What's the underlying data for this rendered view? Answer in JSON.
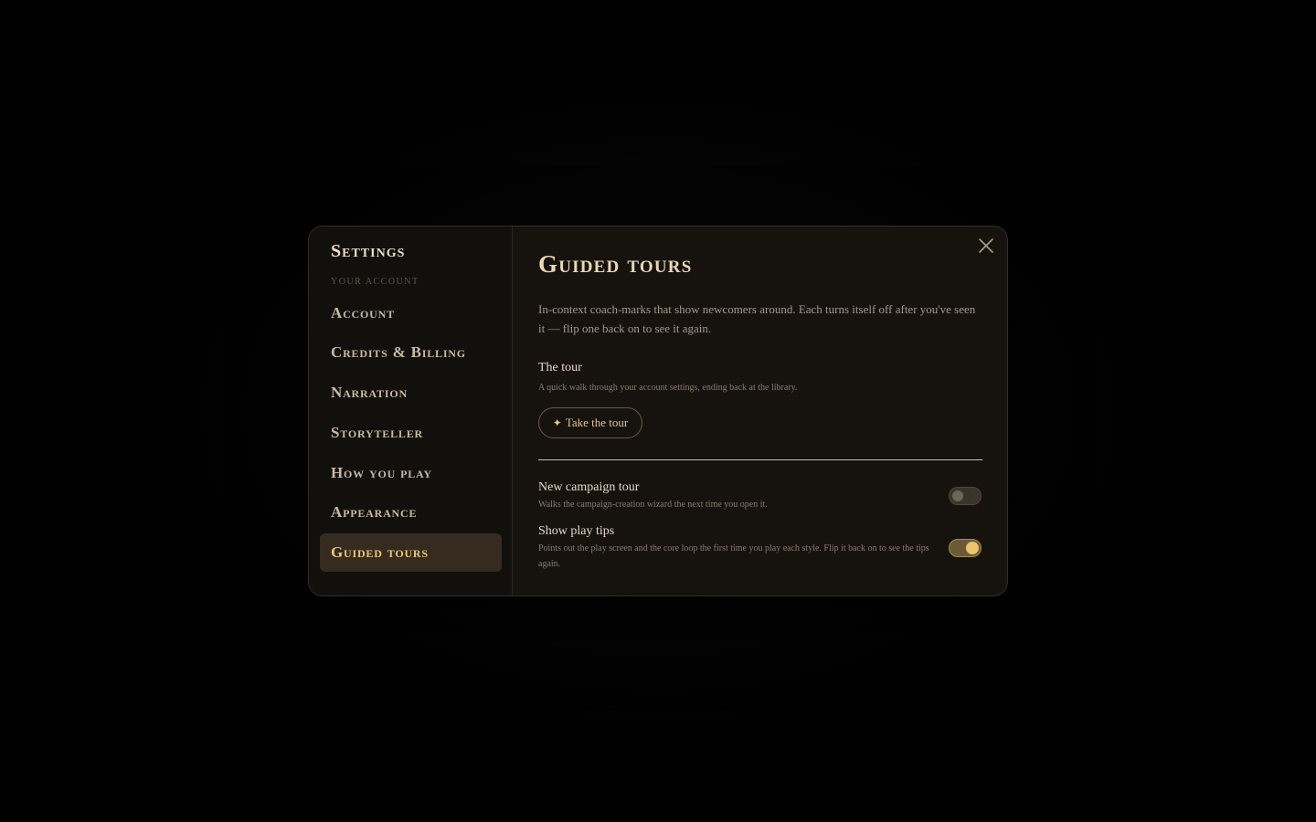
{
  "sidebar": {
    "title": "Settings",
    "section_label": "YOUR ACCOUNT",
    "items": [
      {
        "label": "Account"
      },
      {
        "label": "Credits & Billing"
      },
      {
        "label": "Narration"
      },
      {
        "label": "Storyteller"
      },
      {
        "label": "How you play"
      },
      {
        "label": "Appearance"
      },
      {
        "label": "Guided tours",
        "active": true
      }
    ]
  },
  "main": {
    "title": "Guided tours",
    "intro": "In-context coach-marks that show newcomers around. Each turns itself off after you've seen it — flip one back on to see it again.",
    "tour": {
      "title": "The tour",
      "description": "A quick walk through your account settings, ending back at the library.",
      "button_icon": "sparkle-icon",
      "button_label": "Take the tour"
    },
    "toggles": [
      {
        "title": "New campaign tour",
        "description": "Walks the campaign-creation wizard the next time you open it.",
        "enabled": false
      },
      {
        "title": "Show play tips",
        "description": "Points out the play screen and the core loop the first time you play each style. Flip it back on to see the tips again.",
        "enabled": true
      }
    ],
    "close_icon": "close-icon"
  },
  "colors": {
    "accent": "#eec46a",
    "active_bg": "#352c1f",
    "modal_bg": "#16130f"
  }
}
